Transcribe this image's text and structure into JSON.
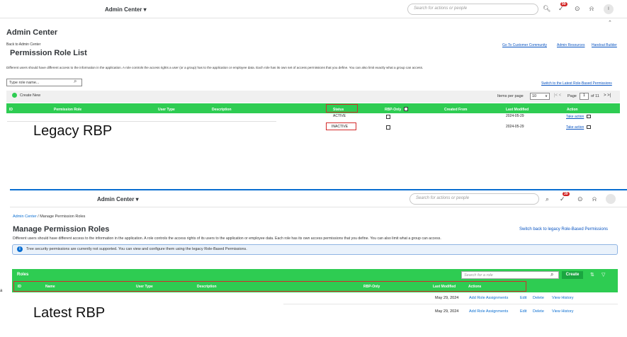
{
  "top": {
    "title": "Admin Center ▾",
    "search_placeholder": "Search for actions or people",
    "notif_count": "99",
    "avatar": "I",
    "page_title": "Admin Center",
    "back_link": "Back to Admin Center",
    "links": [
      "Go To Customer Community",
      "Admin Resources",
      "Handout Builder"
    ],
    "list_title": "Permission Role List",
    "description": "Different users should have different access to the information in the application. A role controls the access rights a user (or a group) has to the application or employee data. Each role has its own set of access permissions that you define. You can also limit exactly what a group can access.",
    "role_search_placeholder": "Type role name...",
    "switch_link": "Switch to the Latest Role-Based Permissions",
    "create_new": "Create New",
    "items_per_page_label": "Items per page",
    "items_per_page": "10",
    "page_label": "Page",
    "page_num": "1",
    "page_of": "of 11",
    "columns": [
      "ID",
      "Permission Role",
      "User Type",
      "Description",
      "Status",
      "RBP-Only",
      "Created From",
      "Last Modified",
      "Action"
    ],
    "rows": [
      {
        "status": "ACTIVE",
        "date": "2024-05-29",
        "action": "Take action"
      },
      {
        "status": "INACTIVE",
        "date": "2024-05-29",
        "action": "Take action"
      }
    ],
    "overlay": "Legacy RBP"
  },
  "bottom": {
    "title": "Admin Center ▾",
    "search_placeholder": "Search for actions or people",
    "notif_count": "39",
    "breadcrumb_link": "Admin Center",
    "breadcrumb_rest": " / Manage Permission Roles",
    "page_title": "Manage Permission Roles",
    "switch_link": "Switch back to legacy Role-Based Permissions",
    "description": "Different users should have different access to the information in the application. A role controls the access rights of its users to the application or employee data. Each role has its own access permissions that you define. You can also limit what a group can access.",
    "info": "Tree security permissions are currently not supported. You can view and configure them using the legacy Role-Based Permissions.",
    "roles_label": "Roles",
    "role_search_placeholder": "Search for a role",
    "create": "Create",
    "columns": [
      "ID",
      "Name",
      "User Type",
      "Description",
      "RBP-Only",
      "Last Modified",
      "Actions"
    ],
    "rows": [
      {
        "date": "May 29, 2024",
        "actions": [
          "Add Role Assignments",
          "Edit",
          "Delete",
          "View History"
        ]
      },
      {
        "date": "May 29, 2024",
        "actions": [
          "Add Role Assignments",
          "Edit",
          "Delete",
          "View History"
        ]
      }
    ],
    "left_char": "a",
    "overlay": "Latest RBP"
  }
}
